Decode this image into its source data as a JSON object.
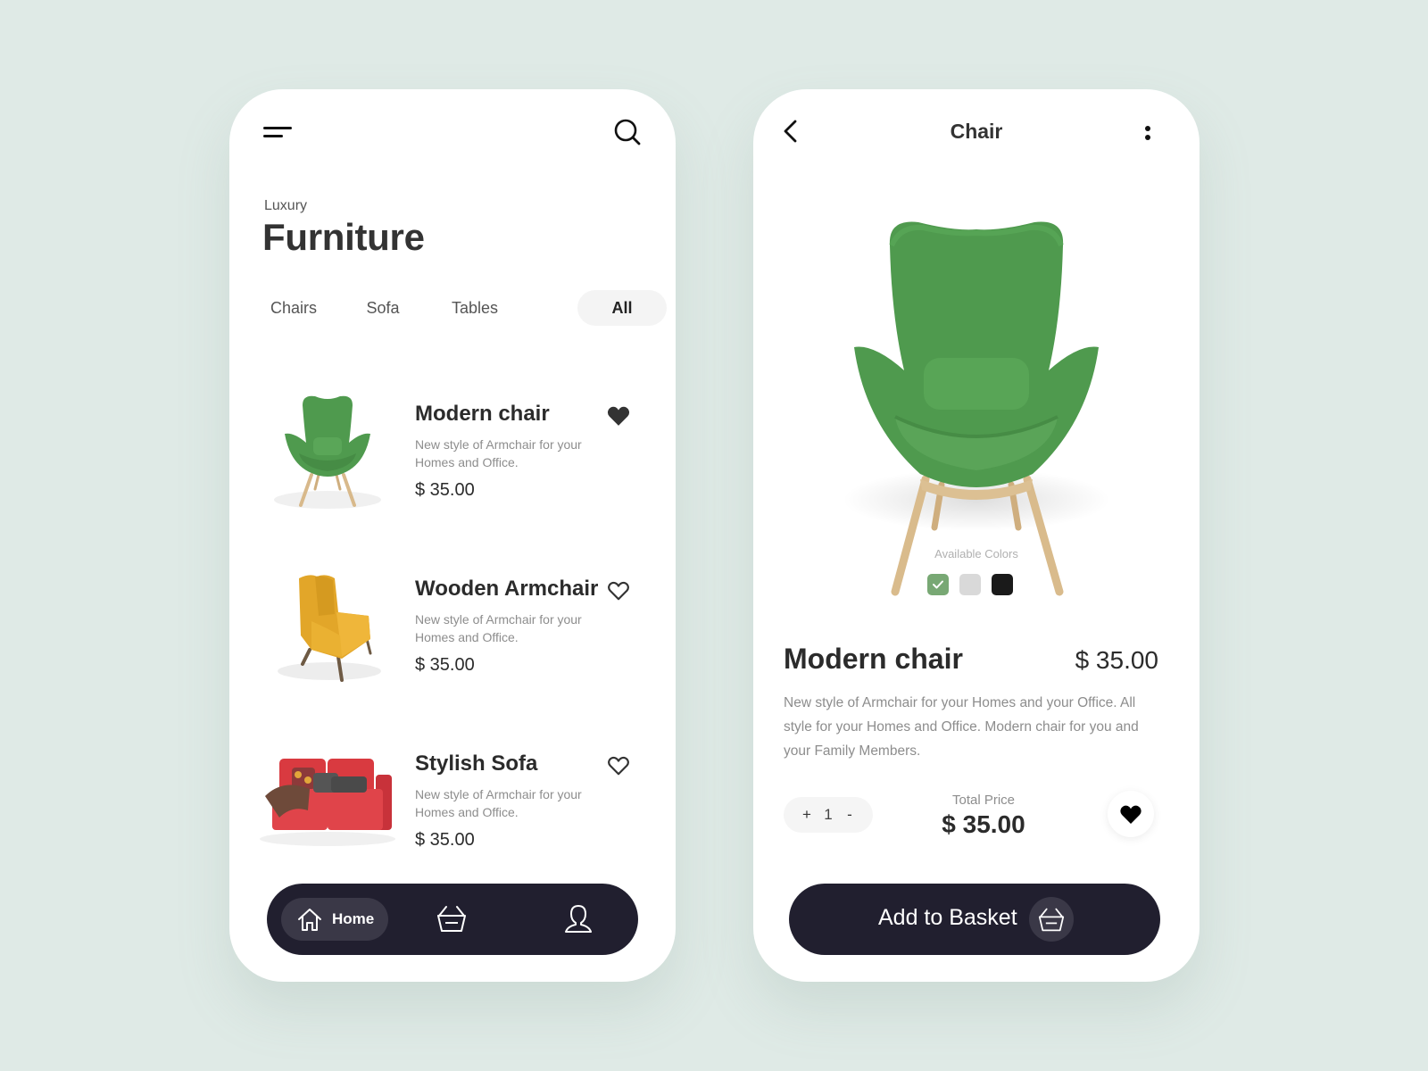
{
  "theme": {
    "background": "#dfeae6",
    "dark": "#211f2f",
    "dark_pill": "#3a3847",
    "muted_text": "#8d8d8d"
  },
  "list_screen": {
    "eyebrow": "Luxury",
    "title": "Furniture",
    "icons": {
      "menu": "menu-icon",
      "search": "search-icon"
    },
    "tabs": [
      {
        "label": "Chairs",
        "active": false
      },
      {
        "label": "Sofa",
        "active": false
      },
      {
        "label": "Tables",
        "active": false
      },
      {
        "label": "All",
        "active": true
      }
    ],
    "products": [
      {
        "name": "Modern chair",
        "description": "New style of Armchair for your Homes and Office.",
        "price": "$ 35.00",
        "favorited": true,
        "image": "green-armchair"
      },
      {
        "name": "Wooden Armchair",
        "description": "New style of Armchair for your Homes and Office.",
        "price": "$ 35.00",
        "favorited": false,
        "image": "yellow-armchair"
      },
      {
        "name": "Stylish Sofa",
        "description": "New style of Armchair for your Homes and Office.",
        "price": "$ 35.00",
        "favorited": false,
        "image": "red-sofa"
      }
    ],
    "bottom_nav": {
      "items": [
        {
          "label": "Home",
          "icon": "home-icon",
          "active": true
        },
        {
          "label": "",
          "icon": "basket-icon",
          "active": false
        },
        {
          "label": "",
          "icon": "user-icon",
          "active": false
        }
      ]
    }
  },
  "detail_screen": {
    "title": "Chair",
    "icons": {
      "back": "back-icon",
      "more": "more-vertical-icon"
    },
    "image": "green-armchair",
    "available_colors_label": "Available Colors",
    "colors": [
      {
        "name": "green",
        "hex": "#78a874",
        "selected": true
      },
      {
        "name": "light-gray",
        "hex": "#d9d9d9",
        "selected": false
      },
      {
        "name": "black",
        "hex": "#1a1a1a",
        "selected": false
      }
    ],
    "product_name": "Modern chair",
    "price": "$ 35.00",
    "description": "New style of Armchair for your Homes and your Office. All style for your Homes and Office. Modern chair for you and your Family Members.",
    "quantity": {
      "plus_label": "+",
      "value": "1",
      "minus_label": "-"
    },
    "total_label": "Total Price",
    "total_value": "$ 35.00",
    "favorited": true,
    "add_to_basket_label": "Add to Basket"
  }
}
